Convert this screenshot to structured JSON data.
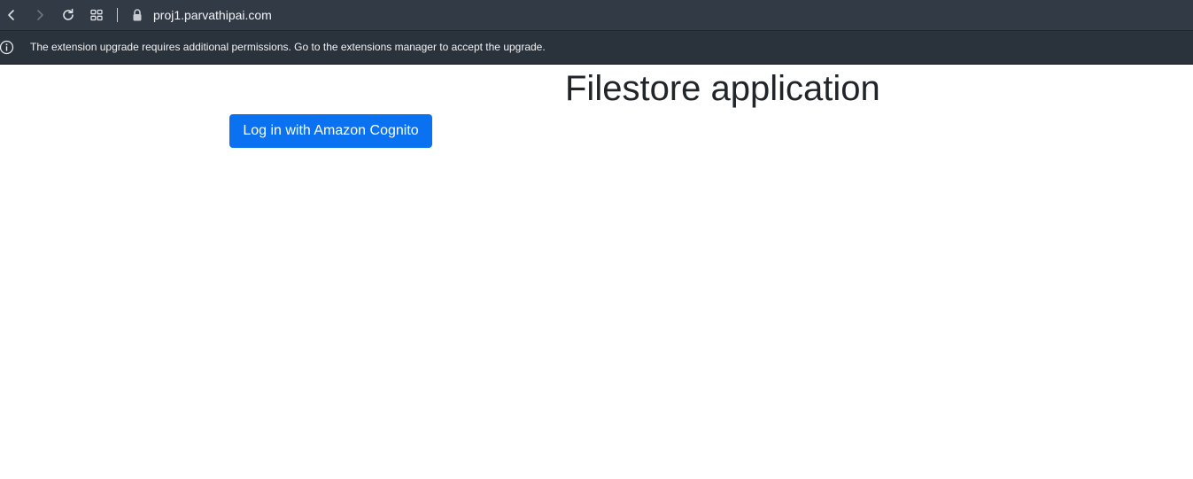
{
  "browser": {
    "url": "proj1.parvathipai.com",
    "icons": {
      "back": "back-icon",
      "forward": "forward-icon",
      "reload": "reload-icon",
      "tabs": "tab-overview-icon",
      "lock": "lock-icon"
    },
    "colors": {
      "toolbar": "#323a45",
      "infobar": "#2a323c"
    }
  },
  "infobar": {
    "icon": "info-icon",
    "message": "The extension upgrade requires additional permissions. Go to the extensions manager to accept the upgrade."
  },
  "page": {
    "title": "Filestore application",
    "login_button_label": "Log in with Amazon Cognito",
    "colors": {
      "button": "#0a72f0",
      "title": "#212529"
    }
  }
}
